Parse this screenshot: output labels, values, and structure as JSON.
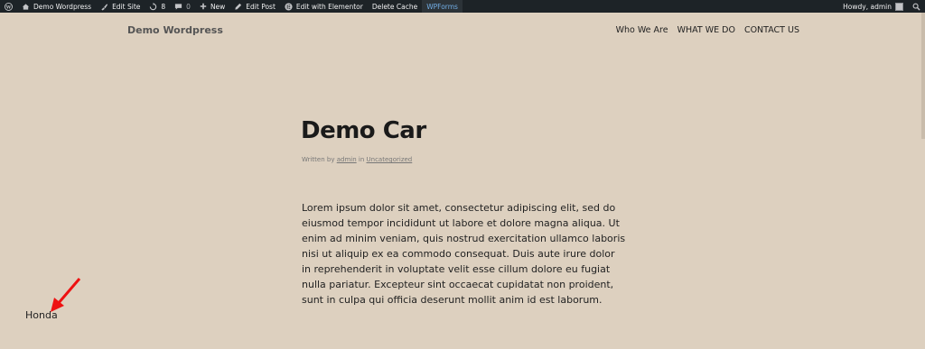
{
  "adminbar": {
    "site_name": "Demo Wordpress",
    "edit_site": "Edit Site",
    "updates_count": "8",
    "comments_count": "0",
    "new_label": "New",
    "edit_post": "Edit Post",
    "edit_elementor": "Edit with Elementor",
    "delete_cache": "Delete Cache",
    "wpforms": "WPForms",
    "howdy": "Howdy, admin"
  },
  "header": {
    "site_title": "Demo Wordpress",
    "nav": [
      "Who We Are",
      "WHAT WE DO",
      "CONTACT US"
    ]
  },
  "post": {
    "title": "Demo Car",
    "meta_prefix": "Written by",
    "author": "admin",
    "meta_in": "in",
    "category": "Uncategorized",
    "body": "Lorem ipsum dolor sit amet, consectetur adipiscing elit, sed do eiusmod tempor incididunt ut labore et dolore magna aliqua. Ut enim ad minim veniam, quis nostrud exercitation ullamco laboris nisi ut aliquip ex ea commodo consequat. Duis aute irure dolor in reprehenderit in voluptate velit esse cillum dolore eu fugiat nulla pariatur. Excepteur sint occaecat cupidatat non proident, sunt in culpa qui officia deserunt mollit anim id est laborum."
  },
  "annotation": {
    "label": "Honda",
    "arrow_color": "#ee1111"
  }
}
